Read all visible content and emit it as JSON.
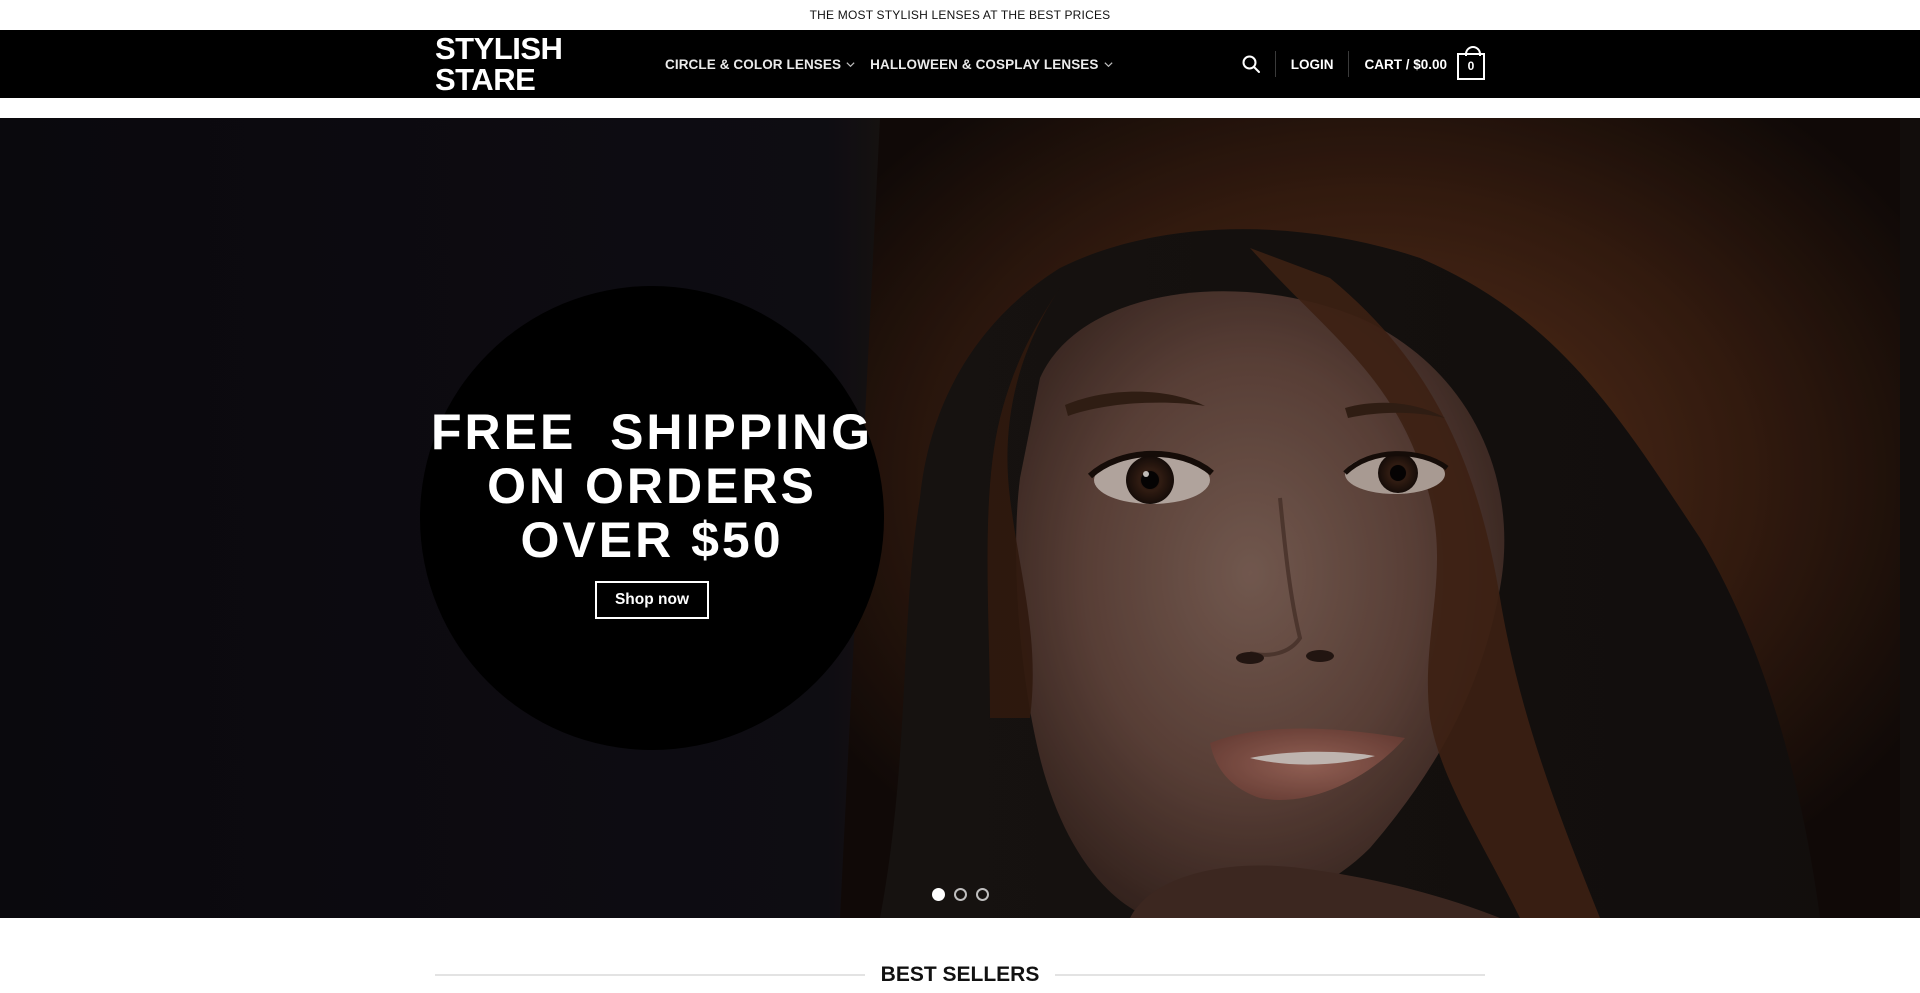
{
  "announcement": "THE MOST STYLISH LENSES AT THE BEST PRICES",
  "logo": {
    "line1": "STYLISH",
    "line2": "STARE"
  },
  "nav": {
    "items": [
      {
        "label": "CIRCLE & COLOR LENSES",
        "icon": "chevron-down-icon"
      },
      {
        "label": "HALLOWEEN & COSPLAY LENSES",
        "icon": "chevron-down-icon"
      }
    ]
  },
  "header": {
    "search_icon": "search-icon",
    "login_label": "LOGIN",
    "cart_label": "CART / $0.00",
    "cart_count": "0"
  },
  "hero": {
    "title_lines": [
      "FREE  SHIPPING",
      "ON ORDERS",
      "OVER $50"
    ],
    "button_label": "Shop now",
    "slides": 3,
    "active_slide": 1
  },
  "sections": {
    "best_sellers_title": "BEST SELLERS"
  },
  "colors": {
    "header_bg": "#000000",
    "hero_bg": "#0e0c12",
    "text_light": "#ffffff"
  }
}
